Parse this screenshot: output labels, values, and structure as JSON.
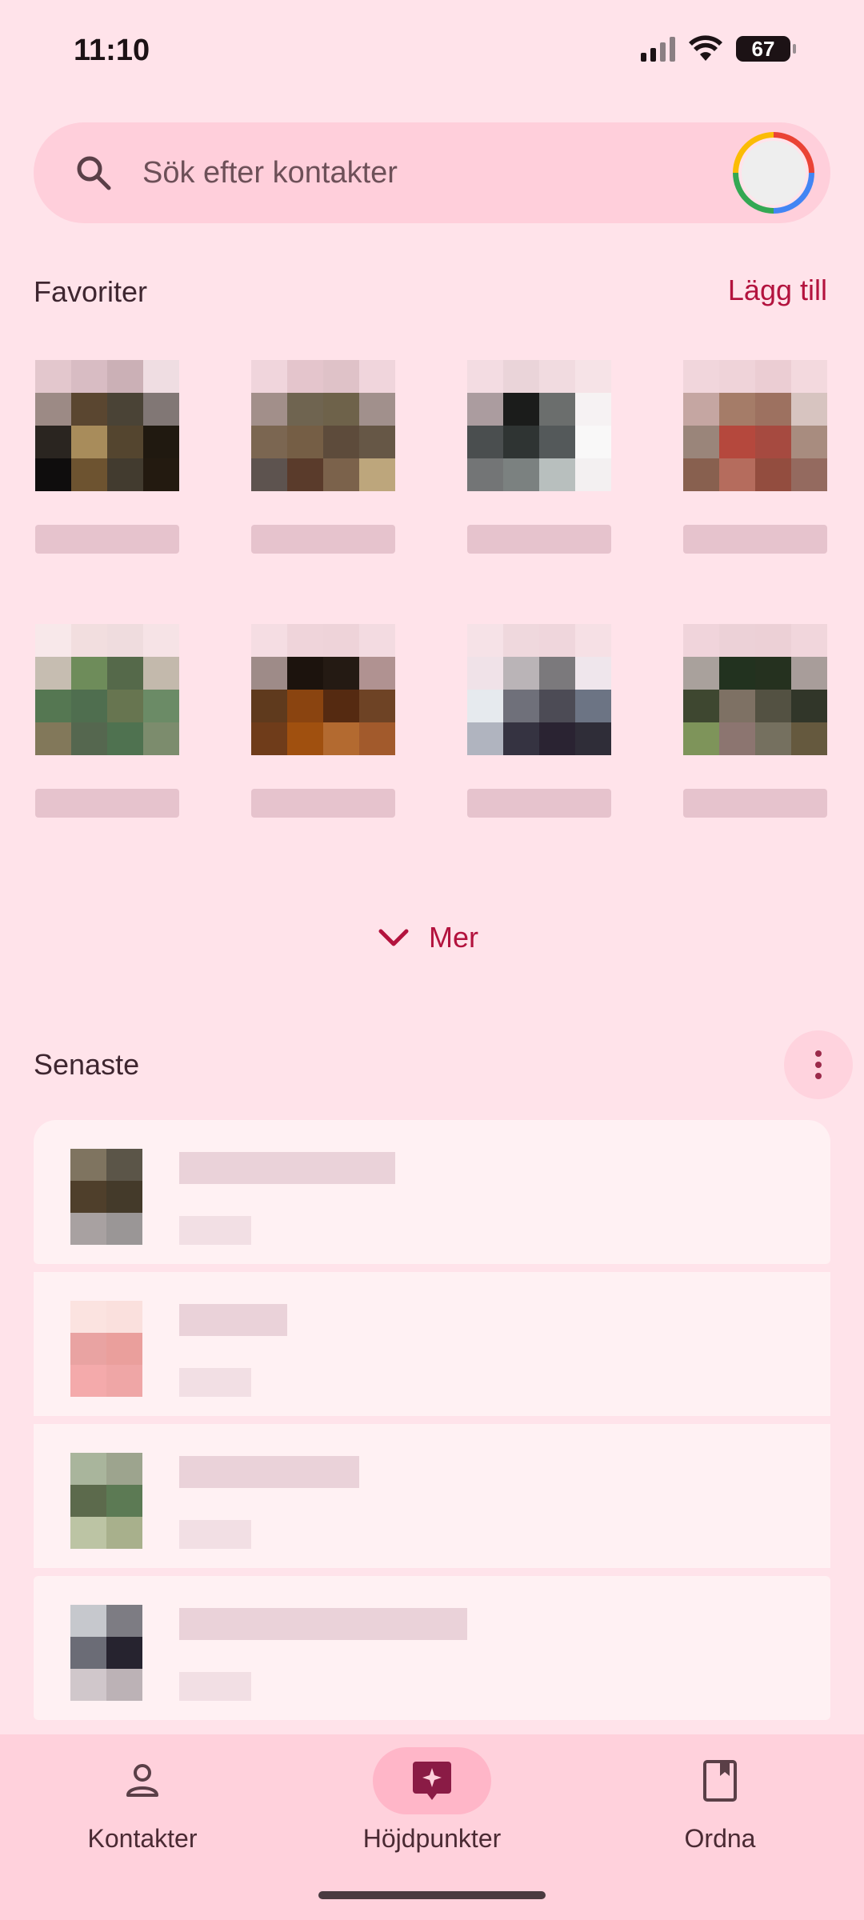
{
  "status_bar": {
    "time": "11:10",
    "battery": "67"
  },
  "search": {
    "placeholder": "Sök efter kontakter"
  },
  "favorites": {
    "title": "Favoriter",
    "add_label": "Lägg till",
    "items": [
      {
        "name": "",
        "palette": [
          "#e3c7cd",
          "#d8bcc3",
          "#cbb0b6",
          "#efdde2",
          "#9c8a85",
          "#5a4630",
          "#4a4336",
          "#817775",
          "#2a2520",
          "#a88c5b",
          "#54452f",
          "#201910",
          "#0f0d0d",
          "#6d5330",
          "#423b2f",
          "#231a10"
        ]
      },
      {
        "name": "",
        "palette": [
          "#f0d5dc",
          "#e4c5cc",
          "#dfc2c8",
          "#f0d5dc",
          "#a28f8a",
          "#6f6450",
          "#6e624a",
          "#a1908c",
          "#7b6651",
          "#755e45",
          "#5d4b3b",
          "#665746",
          "#5d534f",
          "#5a3b2b",
          "#7b624b",
          "#bda67c"
        ]
      },
      {
        "name": "",
        "palette": [
          "#f3dce2",
          "#ead4d9",
          "#f1dbe0",
          "#f6e3e7",
          "#ab9c9f",
          "#1b1c1b",
          "#6b6e6d",
          "#f6f2f3",
          "#4a4e4f",
          "#2f3433",
          "#54595a",
          "#f9f8f8",
          "#737576",
          "#7b8180",
          "#b8bfbe",
          "#f3f0f1"
        ]
      },
      {
        "name": "",
        "palette": [
          "#f1d6dc",
          "#efd3d9",
          "#ebcdd3",
          "#f3d9de",
          "#c5a6a2",
          "#a57c68",
          "#9d7160",
          "#d7c4c0",
          "#9a857a",
          "#b5483d",
          "#a64a40",
          "#a88c7f",
          "#88604f",
          "#b56c5d",
          "#934d3f",
          "#946a5f"
        ]
      },
      {
        "name": "",
        "palette": [
          "#f8e8ea",
          "#f2dedf",
          "#efdcde",
          "#f6e3e6",
          "#c6bdb1",
          "#6e8c5a",
          "#55694a",
          "#c3b9ac",
          "#557752",
          "#4f6e4f",
          "#677550",
          "#6b8b66",
          "#82785a",
          "#55674f",
          "#4f7250",
          "#7c8c6d"
        ]
      },
      {
        "name": "",
        "palette": [
          "#f5dde3",
          "#efd4da",
          "#eed3d9",
          "#f3dbe1",
          "#9e8b88",
          "#1c130d",
          "#241a13",
          "#b09291",
          "#5f3a1d",
          "#8a4410",
          "#552a11",
          "#6e4325",
          "#6f3c1a",
          "#a0500f",
          "#b36a30",
          "#a25a2c"
        ]
      },
      {
        "name": "",
        "palette": [
          "#f6e2e7",
          "#efd8dd",
          "#efd6dc",
          "#f6e0e5",
          "#f0e2e8",
          "#bab4b7",
          "#7b797c",
          "#efe6ec",
          "#e6eaee",
          "#6f707a",
          "#4c4b55",
          "#6c7484",
          "#b0b4bf",
          "#353341",
          "#2a2332",
          "#2f2d38"
        ]
      },
      {
        "name": "",
        "palette": [
          "#f0d4db",
          "#ecd1d7",
          "#ecd0d6",
          "#f1d6dc",
          "#a9a19c",
          "#22321f",
          "#25311f",
          "#a89d9a",
          "#3e4730",
          "#7e7164",
          "#535142",
          "#313629",
          "#7e945a",
          "#8c7570",
          "#75705f",
          "#65593e"
        ]
      }
    ]
  },
  "more": {
    "label": "Mer"
  },
  "recent": {
    "title": "Senaste",
    "items": [
      {
        "name": "",
        "sub": "",
        "name_width": 270,
        "avatar": [
          "#7f7460",
          "#5b5548",
          "#4f3f2b",
          "#443a2a",
          "#a8a1a1",
          "#9a9696"
        ]
      },
      {
        "name": "",
        "sub": "",
        "name_width": 135,
        "avatar": [
          "#fbe3e0",
          "#fae0dd",
          "#e9a3a2",
          "#ea9f9c",
          "#f4aaab",
          "#efa6a6"
        ]
      },
      {
        "name": "",
        "sub": "",
        "name_width": 225,
        "avatar": [
          "#a9b59c",
          "#9da48e",
          "#5c6a4c",
          "#5c7a54",
          "#bcc4a4",
          "#a8b08c"
        ]
      },
      {
        "name": "",
        "sub": "",
        "name_width": 360,
        "avatar": [
          "#c6c8cd",
          "#7d7c83",
          "#6b6c76",
          "#26232f",
          "#d0c7cb",
          "#bcb2b6"
        ]
      }
    ]
  },
  "nav": {
    "items": [
      {
        "label": "Kontakter",
        "icon": "person-icon"
      },
      {
        "label": "Höjdpunkter",
        "icon": "sparkle-icon",
        "active": true
      },
      {
        "label": "Ordna",
        "icon": "bookmark-icon"
      }
    ]
  },
  "colors": {
    "accent": "#b3133e",
    "background": "#ffe3ea",
    "search_bg": "#ffcfdb",
    "nav_bg": "#ffd1dc"
  }
}
